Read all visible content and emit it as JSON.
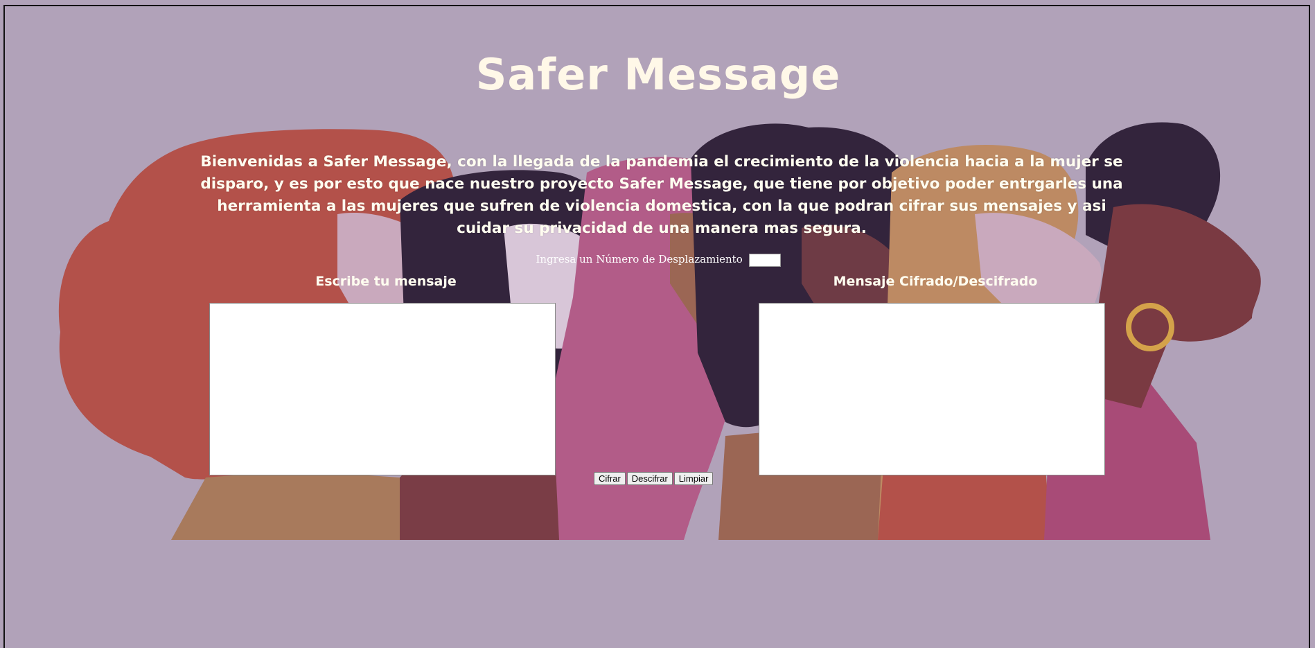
{
  "page": {
    "title": "Safer Message",
    "intro": "Bienvenidas a Safer Message, con la llegada de la pandemia el crecimiento de la violencia hacia a la mujer se disparo, y es por esto que nace nuestro proyecto Safer Message, que tiene por objetivo poder entrgarles una herramienta a las mujeres que sufren de violencia domestica, con la que podran cifrar sus mensajes y asi cuidar su privacidad de una manera mas segura."
  },
  "shift": {
    "label": "Ingresa un Número de Desplazamiento",
    "value": ""
  },
  "input_panel": {
    "label": "Escribe tu mensaje",
    "value": ""
  },
  "output_panel": {
    "label": "Mensaje Cifrado/Descifrado",
    "value": ""
  },
  "actions": {
    "encrypt_label": "Cifrar",
    "decrypt_label": "Descifrar",
    "clear_label": "Limpiar"
  },
  "colors": {
    "background": "#b1a2b9",
    "title_text": "#fff8e8",
    "hair_red": "#b3514a",
    "dark_purple": "#33243c",
    "pink": "#b25c88",
    "skin_brown": "#9b6654"
  }
}
